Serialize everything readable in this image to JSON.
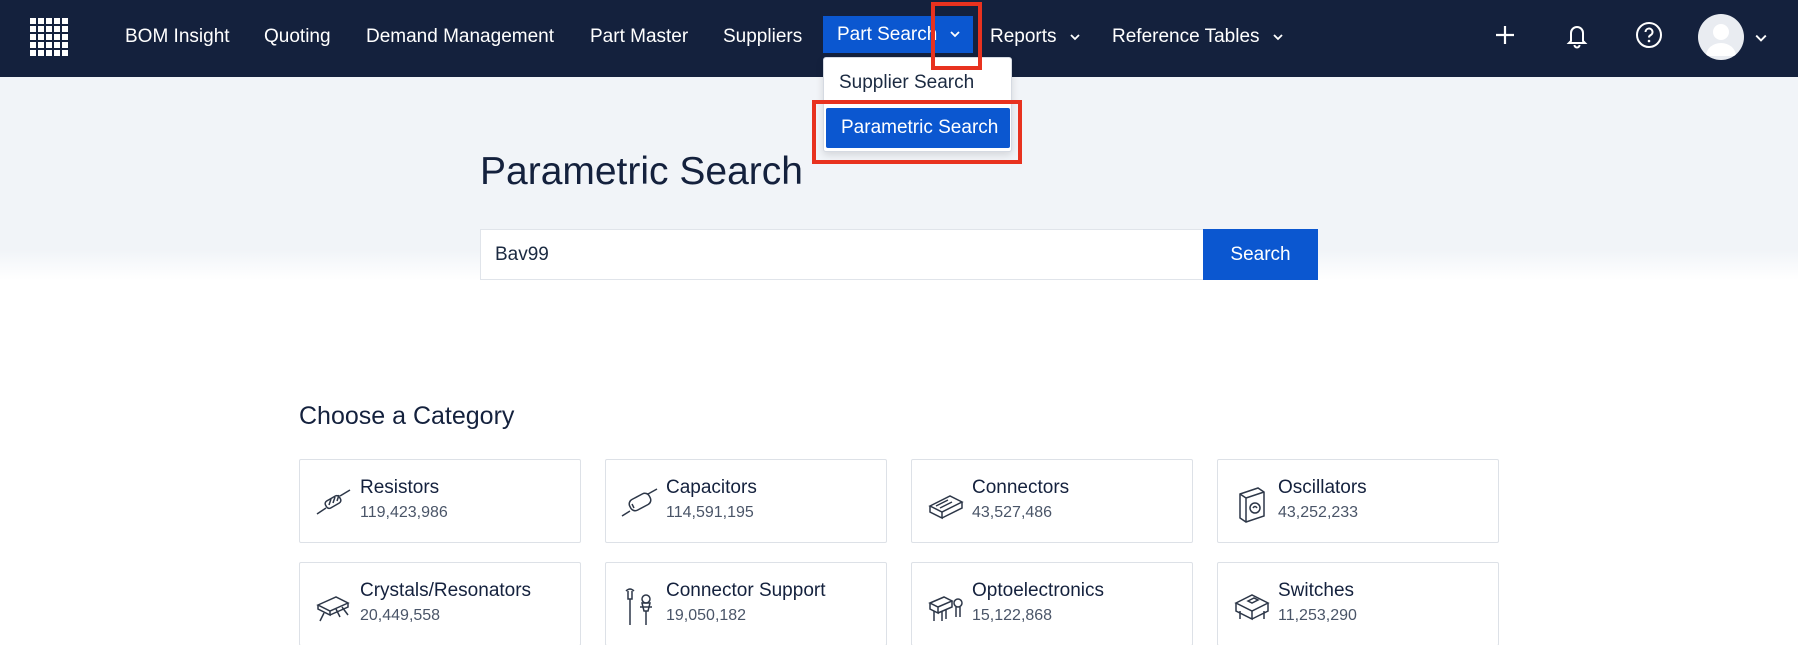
{
  "nav": {
    "items": [
      {
        "label": "BOM Insight"
      },
      {
        "label": "Quoting"
      },
      {
        "label": "Demand Management"
      },
      {
        "label": "Part Master"
      },
      {
        "label": "Suppliers"
      },
      {
        "label": "Part Search"
      },
      {
        "label": "Reports"
      },
      {
        "label": "Reference Tables"
      }
    ],
    "icons": [
      "plus-icon",
      "bell-icon",
      "help-icon",
      "avatar"
    ]
  },
  "dropdown": {
    "items": [
      {
        "label": "Supplier Search"
      },
      {
        "label": "Parametric Search"
      }
    ],
    "selected": "Parametric Search"
  },
  "page": {
    "title": "Parametric Search"
  },
  "search": {
    "value": "Bav99",
    "button_label": "Search"
  },
  "categories": {
    "heading": "Choose a Category",
    "items": [
      {
        "name": "Resistors",
        "count": "119,423,986",
        "icon": "resistor-icon"
      },
      {
        "name": "Capacitors",
        "count": "114,591,195",
        "icon": "capacitor-icon"
      },
      {
        "name": "Connectors",
        "count": "43,527,486",
        "icon": "connector-icon"
      },
      {
        "name": "Oscillators",
        "count": "43,252,233",
        "icon": "oscillator-icon"
      },
      {
        "name": "Crystals/Resonators",
        "count": "20,449,558",
        "icon": "crystal-icon"
      },
      {
        "name": "Connector Support",
        "count": "19,050,182",
        "icon": "connector-support-icon"
      },
      {
        "name": "Optoelectronics",
        "count": "15,122,868",
        "icon": "optoelectronics-icon"
      },
      {
        "name": "Switches",
        "count": "11,253,290",
        "icon": "switch-icon"
      }
    ]
  },
  "colors": {
    "nav_bg": "#14213d",
    "accent": "#0b57d0",
    "highlight": "#e8321f"
  }
}
